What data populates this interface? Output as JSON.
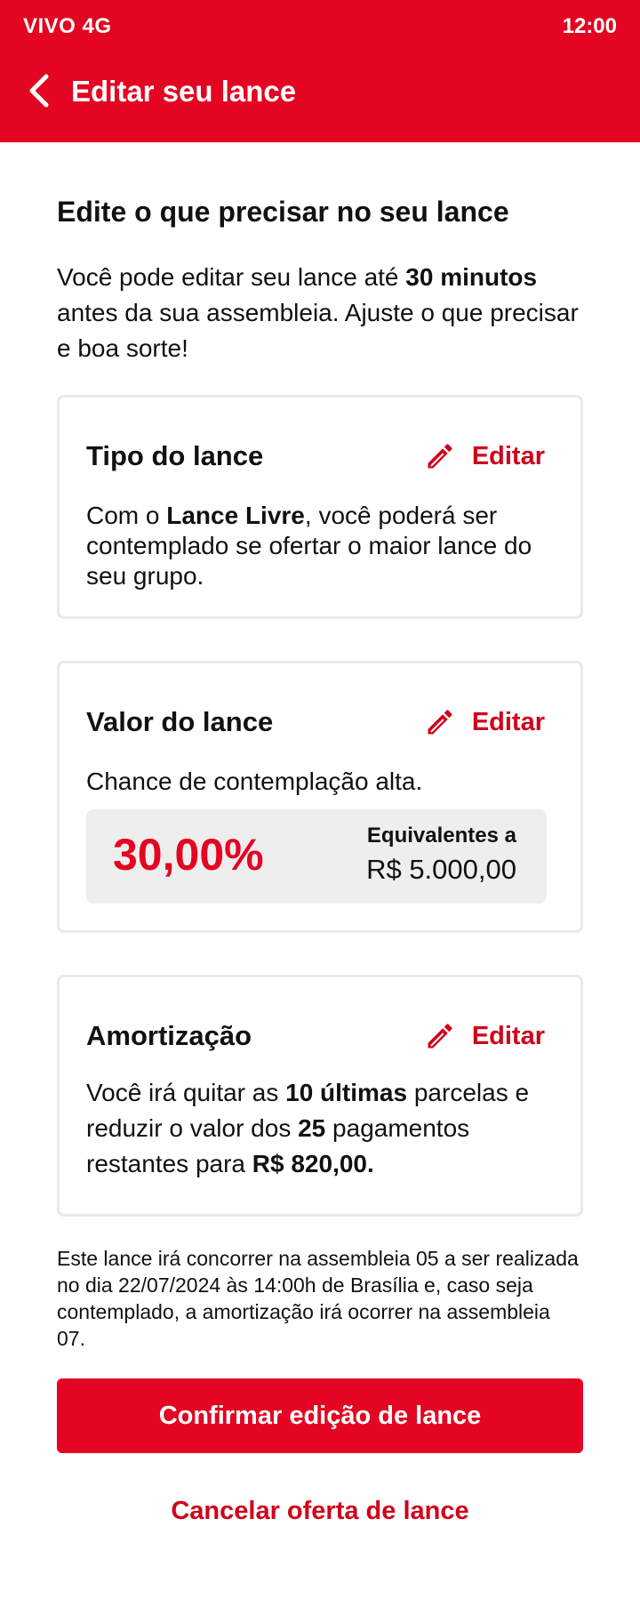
{
  "status_bar": {
    "carrier": "VIVO 4G",
    "time": "12:00"
  },
  "header": {
    "title": "Editar seu lance",
    "back_icon": "chevron-left-icon"
  },
  "intro": {
    "title": "Edite o que precisar no seu lance",
    "text_before": "Você pode editar seu lance até ",
    "text_bold": "30 minutos",
    "text_after": " antes da sua assembleia. Ajuste o que precisar e boa sorte!"
  },
  "cards": {
    "tipo": {
      "title": "Tipo do lance",
      "edit_label": "Editar",
      "text_before": "Com o ",
      "text_bold": "Lance Livre",
      "text_after": ", você poderá ser contemplado se ofertar o maior lance do seu grupo."
    },
    "valor": {
      "title": "Valor do lance",
      "edit_label": "Editar",
      "text": "Chance de contemplação alta.",
      "percentage": "30,00%",
      "equivalent_label": "Equivalentes a",
      "equivalent_value": "R$ 5.000,00"
    },
    "amortizacao": {
      "title": "Amortização",
      "edit_label": "Editar",
      "text_1": "Você irá quitar as ",
      "text_bold_1": "10 últimas",
      "text_2": " parcelas e reduzir o valor dos ",
      "text_bold_2": "25",
      "text_3": " pagamentos restantes para ",
      "text_bold_3": "R$ 820,00."
    }
  },
  "footnote": "Este lance irá concorrer na assembleia 05 a ser realizada no dia 22/07/2024 às 14:00h de Brasília e, caso seja contemplado, a amortização irá ocorrer na assembleia 07.",
  "actions": {
    "confirm_label": "Confirmar edição de lance",
    "cancel_label": "Cancelar oferta de lance"
  },
  "colors": {
    "brand_red": "#e30521",
    "text": "#111111",
    "card_border": "#e9e9e9",
    "value_box_bg": "#eeeeee"
  }
}
